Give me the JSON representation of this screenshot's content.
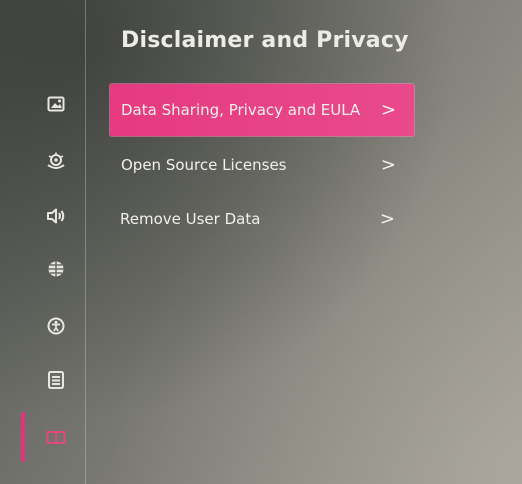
{
  "page": {
    "title": "Disclaimer and Privacy"
  },
  "sidebar": {
    "items": [
      {
        "icon": "picture-icon"
      },
      {
        "icon": "display-icon"
      },
      {
        "icon": "speaker-icon"
      },
      {
        "icon": "globe-icon"
      },
      {
        "icon": "accessibility-icon"
      },
      {
        "icon": "list-icon"
      },
      {
        "icon": "book-icon",
        "active": true
      }
    ]
  },
  "menu": {
    "items": [
      {
        "label": "Data Sharing, Privacy and EULA",
        "chevron": ">",
        "selected": true
      },
      {
        "label": "Open Source Licenses",
        "chevron": ">"
      },
      {
        "label": "Remove User Data",
        "chevron": ">"
      }
    ]
  },
  "colors": {
    "accent": "#e63a80",
    "text": "#f1f0ec"
  }
}
